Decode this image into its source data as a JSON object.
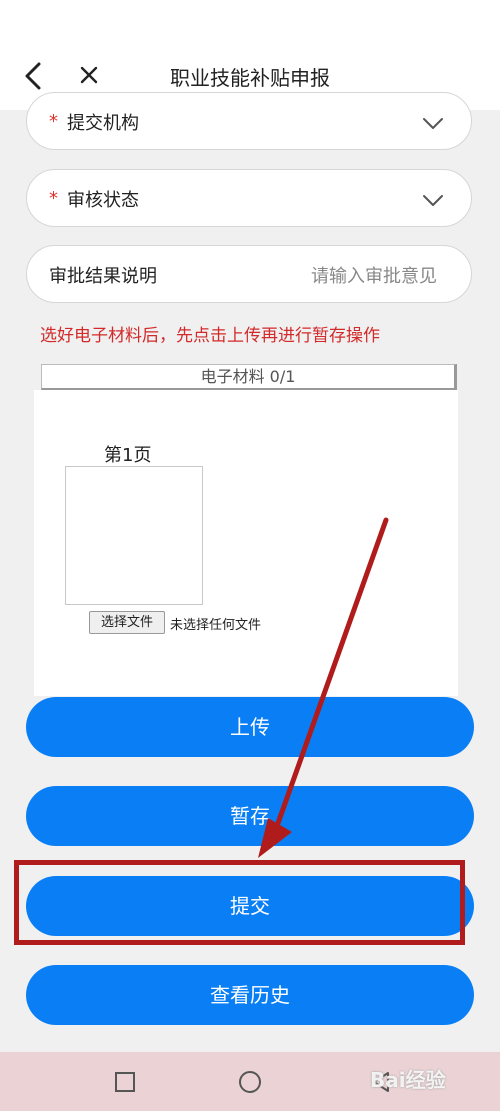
{
  "header": {
    "title": "职业技能补贴申报"
  },
  "form": {
    "institution": {
      "required_mark": "*",
      "label": "提交机构"
    },
    "review_status": {
      "required_mark": "*",
      "label": "审核状态"
    },
    "approval_note": {
      "label": "审批结果说明",
      "placeholder": "请输入审批意见"
    }
  },
  "notice": "选好电子材料后，先点击上传再进行暂存操作",
  "materials": {
    "header": "电子材料 0/1",
    "page_label": "第1页",
    "choose_file_label": "选择文件",
    "file_status": "未选择任何文件"
  },
  "buttons": {
    "upload": "上传",
    "save_draft": "暂存",
    "submit": "提交",
    "history": "查看历史"
  },
  "watermark": "Bai经验",
  "colors": {
    "primary": "#0a7ff5",
    "required": "#e0332e",
    "notice": "#d22a2a",
    "annotation": "#b01c1c",
    "navbar": "#ebd3d5"
  }
}
